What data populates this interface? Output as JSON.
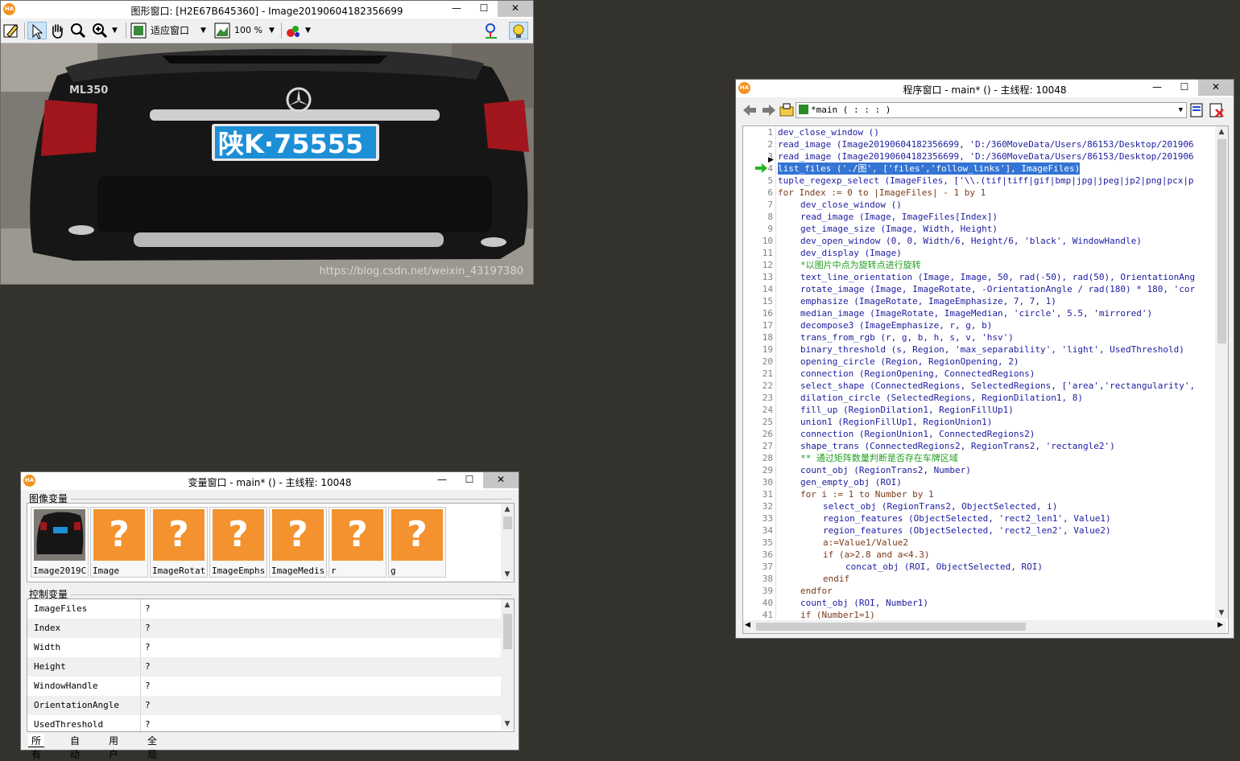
{
  "graphics_window": {
    "title": "图形窗口: [H2E67B645360] - Image20190604182356699",
    "toolbar": {
      "fit_label": "适应窗口",
      "zoom_label": "100 %"
    },
    "image_watermark": "https://blog.csdn.net/weixin_43197380",
    "plate_text": "陕K·75555"
  },
  "variable_window": {
    "title": "变量窗口 - main* () - 主线程: 10048",
    "iconic_label": "图像变量",
    "control_label": "控制变量",
    "iconic_vars": [
      "Image2019C",
      "Image",
      "ImageRotat",
      "ImageEmphs",
      "ImageMedis",
      "r",
      "g"
    ],
    "unknown_glyph": "?",
    "control_vars": [
      {
        "name": "ImageFiles",
        "value": "?"
      },
      {
        "name": "Index",
        "value": "?"
      },
      {
        "name": "Width",
        "value": "?"
      },
      {
        "name": "Height",
        "value": "?"
      },
      {
        "name": "WindowHandle",
        "value": "?"
      },
      {
        "name": "OrientationAngle",
        "value": "?"
      },
      {
        "name": "UsedThreshold",
        "value": "?"
      }
    ],
    "tabs": [
      "所有",
      "自动",
      "用户",
      "全局"
    ]
  },
  "program_window": {
    "title": "程序窗口 - main* () - 主线程: 10048",
    "procedure": "*main ( : : : )",
    "current_line": 4,
    "lines": [
      {
        "n": "1",
        "indent": 0,
        "kind": "op",
        "text": "dev_close_window ()"
      },
      {
        "n": "2",
        "indent": 0,
        "kind": "op",
        "text": "read_image (Image20190604182356699, 'D:/360MoveData/Users/86153/Desktop/201906"
      },
      {
        "n": "3",
        "indent": 0,
        "kind": "op",
        "text": "read_image (Image20190604182356699, 'D:/360MoveData/Users/86153/Desktop/201906"
      },
      {
        "n": "4",
        "indent": 0,
        "kind": "hl",
        "text": "list_files ('./图', ['files','follow_links'], ImageFiles)"
      },
      {
        "n": "5",
        "indent": 0,
        "kind": "op",
        "text": "tuple_regexp_select (ImageFiles, ['\\\\.(tif|tiff|gif|bmp|jpg|jpeg|jp2|png|pcx|p"
      },
      {
        "n": "6",
        "indent": 0,
        "kind": "ctrl",
        "text": "for Index := 0 to |ImageFiles| - 1 by 1"
      },
      {
        "n": "7",
        "indent": 1,
        "kind": "op",
        "text": "dev_close_window ()"
      },
      {
        "n": "8",
        "indent": 1,
        "kind": "op",
        "text": "read_image (Image, ImageFiles[Index])"
      },
      {
        "n": "9",
        "indent": 1,
        "kind": "op",
        "text": "get_image_size (Image, Width, Height)"
      },
      {
        "n": "10",
        "indent": 1,
        "kind": "op",
        "text": "dev_open_window (0, 0, Width/6, Height/6, 'black', WindowHandle)"
      },
      {
        "n": "11",
        "indent": 1,
        "kind": "op",
        "text": "dev_display (Image)"
      },
      {
        "n": "12",
        "indent": 1,
        "kind": "comment",
        "text": "*以图片中点为旋转点进行旋转"
      },
      {
        "n": "13",
        "indent": 1,
        "kind": "op",
        "text": "text_line_orientation (Image, Image, 50, rad(-50), rad(50), OrientationAng"
      },
      {
        "n": "14",
        "indent": 1,
        "kind": "op",
        "text": "rotate_image (Image, ImageRotate, -OrientationAngle / rad(180) * 180, 'cor"
      },
      {
        "n": "15",
        "indent": 1,
        "kind": "op",
        "text": "emphasize (ImageRotate, ImageEmphasize, 7, 7, 1)"
      },
      {
        "n": "16",
        "indent": 1,
        "kind": "op",
        "text": "median_image (ImageRotate, ImageMedian, 'circle', 5.5, 'mirrored')"
      },
      {
        "n": "17",
        "indent": 1,
        "kind": "op",
        "text": "decompose3 (ImageEmphasize, r, g, b)"
      },
      {
        "n": "18",
        "indent": 1,
        "kind": "op",
        "text": "trans_from_rgb (r, g, b, h, s, v, 'hsv')"
      },
      {
        "n": "19",
        "indent": 1,
        "kind": "op",
        "text": "binary_threshold (s, Region, 'max_separability', 'light', UsedThreshold)"
      },
      {
        "n": "20",
        "indent": 1,
        "kind": "op",
        "text": "opening_circle (Region, RegionOpening, 2)"
      },
      {
        "n": "21",
        "indent": 1,
        "kind": "op",
        "text": "connection (RegionOpening, ConnectedRegions)"
      },
      {
        "n": "22",
        "indent": 1,
        "kind": "op",
        "text": "select_shape (ConnectedRegions, SelectedRegions, ['area','rectangularity',"
      },
      {
        "n": "23",
        "indent": 1,
        "kind": "op",
        "text": "dilation_circle (SelectedRegions, RegionDilation1, 8)"
      },
      {
        "n": "24",
        "indent": 1,
        "kind": "op",
        "text": "fill_up (RegionDilation1, RegionFillUp1)"
      },
      {
        "n": "25",
        "indent": 1,
        "kind": "op",
        "text": "union1 (RegionFillUp1, RegionUnion1)"
      },
      {
        "n": "26",
        "indent": 1,
        "kind": "op",
        "text": "connection (RegionUnion1, ConnectedRegions2)"
      },
      {
        "n": "27",
        "indent": 1,
        "kind": "op",
        "text": "shape_trans (ConnectedRegions2, RegionTrans2, 'rectangle2')"
      },
      {
        "n": "28",
        "indent": 1,
        "kind": "comment",
        "text": "** 通过矩阵数量判断是否存在车牌区域"
      },
      {
        "n": "29",
        "indent": 1,
        "kind": "op",
        "text": "count_obj (RegionTrans2, Number)"
      },
      {
        "n": "30",
        "indent": 1,
        "kind": "op",
        "text": "gen_empty_obj (ROI)"
      },
      {
        "n": "31",
        "indent": 1,
        "kind": "ctrl",
        "text": "for i := 1 to Number by 1"
      },
      {
        "n": "32",
        "indent": 2,
        "kind": "op",
        "text": "select_obj (RegionTrans2, ObjectSelected, i)"
      },
      {
        "n": "33",
        "indent": 2,
        "kind": "op",
        "text": "region_features (ObjectSelected, 'rect2_len1', Value1)"
      },
      {
        "n": "34",
        "indent": 2,
        "kind": "op",
        "text": "region_features (ObjectSelected, 'rect2_len2', Value2)"
      },
      {
        "n": "35",
        "indent": 2,
        "kind": "ctrl",
        "text": "a:=Value1/Value2"
      },
      {
        "n": "36",
        "indent": 2,
        "kind": "ctrl",
        "text": "if (a>2.8 and a<4.3)"
      },
      {
        "n": "37",
        "indent": 3,
        "kind": "op",
        "text": "concat_obj (ROI, ObjectSelected, ROI)"
      },
      {
        "n": "38",
        "indent": 2,
        "kind": "ctrl",
        "text": "endif"
      },
      {
        "n": "39",
        "indent": 1,
        "kind": "ctrl",
        "text": "endfor"
      },
      {
        "n": "40",
        "indent": 1,
        "kind": "op",
        "text": "count_obj (ROI, Number1)"
      },
      {
        "n": "41",
        "indent": 1,
        "kind": "ctrl",
        "text": "if (Number1=1)"
      }
    ]
  },
  "colors": {
    "desktop": "#34322d",
    "halcon_orange": "#f3921e",
    "selection": "#3374d4",
    "comment": "#1f9f1f",
    "operator": "#1c1ca0",
    "current_line_arrow": "#22b422"
  }
}
